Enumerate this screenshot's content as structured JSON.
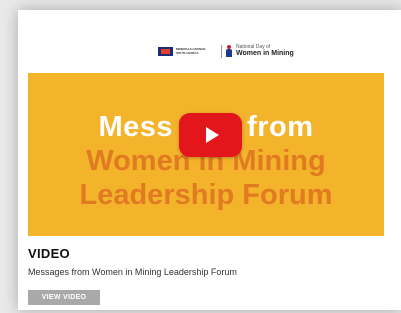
{
  "thumbnail": {
    "header": {
      "minerals_council_logo_text": "MINERALS COUNCIL SOUTH AFRICA",
      "event_small_text": "National Day of",
      "event_big_text": "Women in Mining"
    },
    "banner": {
      "line1_left": "Mess",
      "line1_right": "from",
      "line2": "Women in Mining",
      "line3": "Leadership Forum"
    },
    "play_icon": "youtube-play-icon"
  },
  "card": {
    "category": "VIDEO",
    "description": "Messages from Women in Mining Leadership Forum",
    "button_label": "VIEW VIDEO"
  },
  "colors": {
    "banner_yellow": "#f3b32b",
    "banner_orange_text": "#e07b22",
    "play_red": "#e3161b",
    "button_gray": "#a9a9a9"
  }
}
